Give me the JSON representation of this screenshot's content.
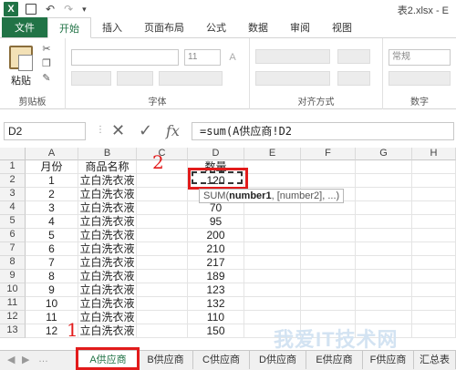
{
  "titlebar": {
    "app_icon_letter": "X",
    "undo": "↶",
    "redo": "↷",
    "more": "▾",
    "title": "表2.xlsx - E"
  },
  "ribbon_tabs": [
    "文件",
    "开始",
    "插入",
    "页面布局",
    "公式",
    "数据",
    "审阅",
    "视图"
  ],
  "ribbon": {
    "paste_label": "粘贴",
    "font_size": "11",
    "number_format": "常规",
    "clipboard_label": "剪贴板",
    "font_label": "字体",
    "alignment_label": "对齐方式",
    "number_label": "数字"
  },
  "formula_bar": {
    "name_box": "D2",
    "cancel_glyph": "✕",
    "enter_glyph": "✓",
    "fx_label": "fx",
    "formula": "=sum(A供应商!D2"
  },
  "columns": [
    "A",
    "B",
    "C",
    "D",
    "E",
    "F",
    "G",
    "H"
  ],
  "rows": [
    [
      "1",
      "月份",
      "商品名称",
      "",
      "数量"
    ],
    [
      "2",
      "1",
      "立白洗衣液",
      "",
      "120"
    ],
    [
      "3",
      "2",
      "立白洗衣液",
      "",
      ""
    ],
    [
      "4",
      "3",
      "立白洗衣液",
      "",
      "70"
    ],
    [
      "5",
      "4",
      "立白洗衣液",
      "",
      "95"
    ],
    [
      "6",
      "5",
      "立白洗衣液",
      "",
      "200"
    ],
    [
      "7",
      "6",
      "立白洗衣液",
      "",
      "210"
    ],
    [
      "8",
      "7",
      "立白洗衣液",
      "",
      "217"
    ],
    [
      "9",
      "8",
      "立白洗衣液",
      "",
      "189"
    ],
    [
      "10",
      "9",
      "立白洗衣液",
      "",
      "123"
    ],
    [
      "11",
      "10",
      "立白洗衣液",
      "",
      "132"
    ],
    [
      "12",
      "11",
      "立白洗衣液",
      "",
      "110"
    ],
    [
      "13",
      "12",
      "立白洗衣液",
      "",
      "150"
    ]
  ],
  "tooltip": {
    "fn": "SUM(",
    "arg1": "number1",
    "rest": ", [number2], ...)"
  },
  "annotations": {
    "step1": "1",
    "step2": "2"
  },
  "sheet_tabs": [
    "A供应商",
    "B供应商",
    "C供应商",
    "D供应商",
    "E供应商",
    "F供应商",
    "汇总表"
  ],
  "watermark": {
    "text": "我爱IT技术网"
  },
  "colors": {
    "excel_green": "#217346",
    "annotation_red": "#e21b1b"
  }
}
